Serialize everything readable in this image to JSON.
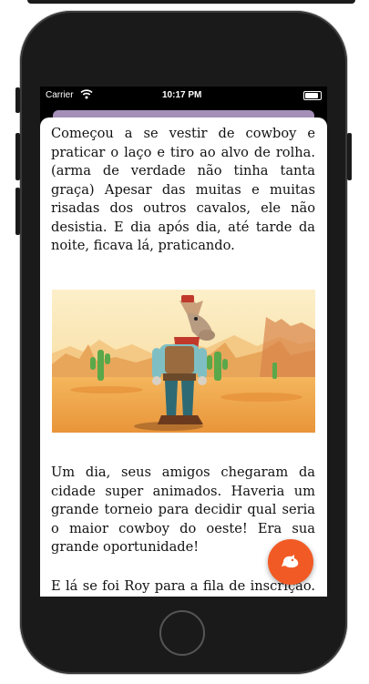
{
  "status_bar": {
    "carrier": "Carrier",
    "time": "10:17 PM",
    "wifi_icon": "wifi-icon",
    "battery_icon": "battery-icon"
  },
  "story": {
    "paragraph_1": "Começou a se vestir de cowboy e praticar o laço e tiro ao alvo de rolha. (arma de verdade não tinha tanta graça) Apesar das muitas e muitas risadas dos outros cavalos, ele não desistia. E dia após dia, até tarde da noite, ficava lá, praticando.",
    "paragraph_2": "Um dia, seus amigos chegaram da cidade super animados. Haveria um grande torneio para decidir qual seria o maior cowboy do oeste! Era sua grande oportunidade!",
    "paragraph_3": "E lá se foi Roy para a fila de inscrição. Ao"
  },
  "illustration": {
    "icon": "cowboy-horse-illustration"
  },
  "fab": {
    "icon": "bird-icon",
    "color": "#f15a24"
  },
  "colors": {
    "phone_body": "#1a1a1a",
    "header_bar": "#a38fb8",
    "sky": "#fbe7b6",
    "ground": "#f0a94c"
  }
}
